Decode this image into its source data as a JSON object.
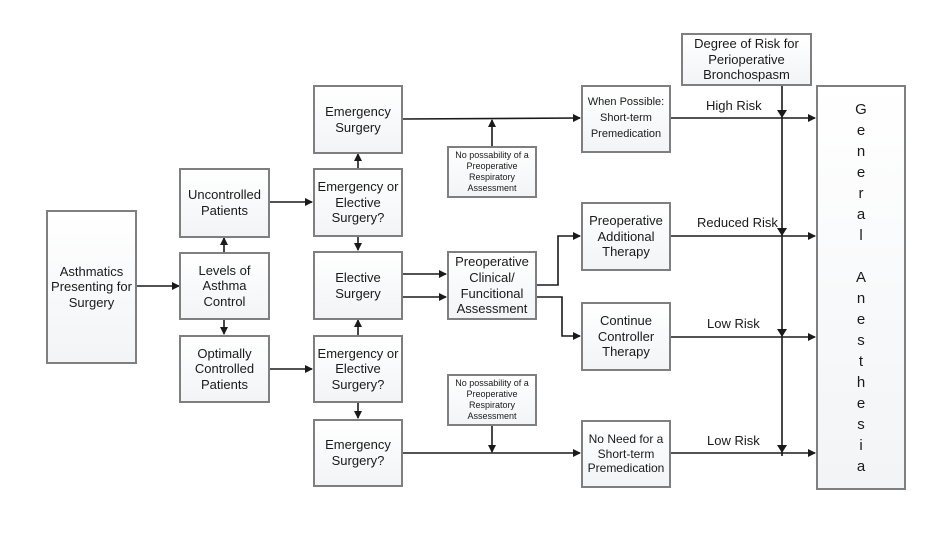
{
  "diagram": {
    "nodes": {
      "asthmatics": "Asthmatics\nPresenting for\nSurgery",
      "levels": "Levels of\nAsthma\nControl",
      "uncontrolled": "Uncontrolled\nPatients",
      "optimally": "Optimally\nControlled\nPatients",
      "emergency_top": "Emergency\nSurgery",
      "em_or_el_top": "Emergency or\nElective\nSurgery?",
      "elective": "Elective\nSurgery",
      "em_or_el_bottom": "Emergency or\nElective\nSurgery?",
      "emergency_bottom": "Emergency\nSurgery?",
      "no_possibility_top": "No possability of a\nPreoperative\nRespiratory\nAssessment",
      "preop_clinical": "Preoperative\nClinical/\nFuncitional\nAssessment",
      "no_possibility_bottom": "No possability of a\nPreoperative\nRespiratory\nAssessment",
      "when_possible": "When Possible:\nShort-term\nPremedication",
      "preop_additional": "Preoperative\nAdditional\nTherapy",
      "continue_controller": "Continue\nController\nTherapy",
      "no_need": "No Need for a\nShort-term\nPremedication",
      "degree_of_risk": "Degree of Risk for\nPerioperative\nBronchospasm",
      "general_anesthesia": [
        "G",
        "e",
        "n",
        "e",
        "r",
        "a",
        "l",
        " ",
        "A",
        "n",
        "e",
        "s",
        "t",
        "h",
        "e",
        "s",
        "i",
        "a"
      ]
    },
    "edge_labels": {
      "high_risk": "High Risk",
      "reduced_risk": "Reduced Risk",
      "low_risk_1": "Low Risk",
      "low_risk_2": "Low Risk"
    },
    "colors": {
      "border": "#7f7f7f",
      "line": "#1a1a1a"
    }
  }
}
